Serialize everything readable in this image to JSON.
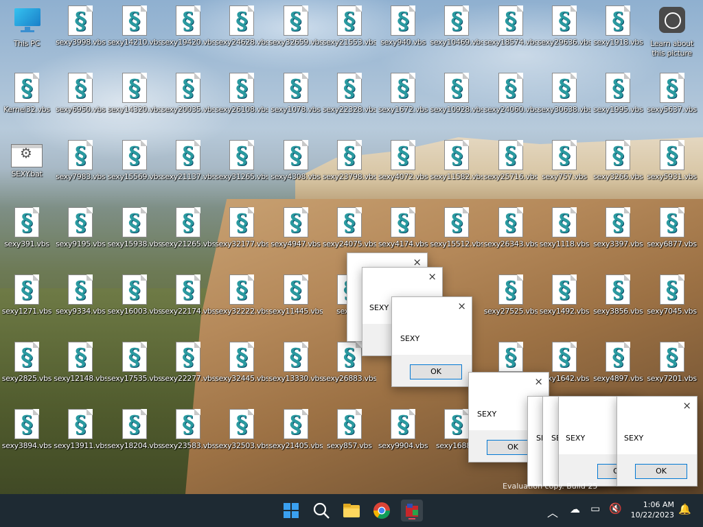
{
  "desktop": {
    "icons": [
      {
        "label": "This PC",
        "kind": "pc"
      },
      {
        "label": "sexy3998.vbs",
        "kind": "vbs"
      },
      {
        "label": "sexy14210.vbs",
        "kind": "vbs"
      },
      {
        "label": "sexy19420.vbs",
        "kind": "vbs"
      },
      {
        "label": "sexy24628.vbs",
        "kind": "vbs"
      },
      {
        "label": "sexy32659.vbs",
        "kind": "vbs"
      },
      {
        "label": "sexy21553.vbs",
        "kind": "vbs"
      },
      {
        "label": "sexy940.vbs",
        "kind": "vbs"
      },
      {
        "label": "sexy10469.vbs",
        "kind": "vbs"
      },
      {
        "label": "sexy18574.vbs",
        "kind": "vbs"
      },
      {
        "label": "sexy29636.vbs",
        "kind": "vbs"
      },
      {
        "label": "sexy1918.vbs",
        "kind": "vbs"
      },
      {
        "label": "Learn about this picture",
        "kind": "camera"
      },
      {
        "label": "Kernel32.vbs",
        "kind": "vbs"
      },
      {
        "label": "sexy6950.vbs",
        "kind": "vbs"
      },
      {
        "label": "sexy14320.vbs",
        "kind": "vbs"
      },
      {
        "label": "sexy20035.vbs",
        "kind": "vbs"
      },
      {
        "label": "sexy26108.vbs",
        "kind": "vbs"
      },
      {
        "label": "sexy1078.vbs",
        "kind": "vbs"
      },
      {
        "label": "sexy22328.vbs",
        "kind": "vbs"
      },
      {
        "label": "sexy1672.vbs",
        "kind": "vbs"
      },
      {
        "label": "sexy10928.vbs",
        "kind": "vbs"
      },
      {
        "label": "sexy24060.vbs",
        "kind": "vbs"
      },
      {
        "label": "sexy30638.vbs",
        "kind": "vbs"
      },
      {
        "label": "sexy1995.vbs",
        "kind": "vbs"
      },
      {
        "label": "sexy5637.vbs",
        "kind": "vbs"
      },
      {
        "label": "SEXY.bat",
        "kind": "bat"
      },
      {
        "label": "sexy7983.vbs",
        "kind": "vbs"
      },
      {
        "label": "sexy15569.vbs",
        "kind": "vbs"
      },
      {
        "label": "sexy21137.vbs",
        "kind": "vbs"
      },
      {
        "label": "sexy31265.vbs",
        "kind": "vbs"
      },
      {
        "label": "sexy4308.vbs",
        "kind": "vbs"
      },
      {
        "label": "sexy23798.vbs",
        "kind": "vbs"
      },
      {
        "label": "sexy4072.vbs",
        "kind": "vbs"
      },
      {
        "label": "sexy11582.vbs",
        "kind": "vbs"
      },
      {
        "label": "sexy25716.vbs",
        "kind": "vbs"
      },
      {
        "label": "sexy757.vbs",
        "kind": "vbs"
      },
      {
        "label": "sexy3266.vbs",
        "kind": "vbs"
      },
      {
        "label": "sexy5931.vbs",
        "kind": "vbs"
      },
      {
        "label": "sexy391.vbs",
        "kind": "vbs"
      },
      {
        "label": "sexy9195.vbs",
        "kind": "vbs"
      },
      {
        "label": "sexy15938.vbs",
        "kind": "vbs"
      },
      {
        "label": "sexy21265.vbs",
        "kind": "vbs"
      },
      {
        "label": "sexy32177.vbs",
        "kind": "vbs"
      },
      {
        "label": "sexy4947.vbs",
        "kind": "vbs"
      },
      {
        "label": "sexy24075.vbs",
        "kind": "vbs"
      },
      {
        "label": "sexy4174.vbs",
        "kind": "vbs"
      },
      {
        "label": "sexy15512.vbs",
        "kind": "vbs"
      },
      {
        "label": "sexy26343.vbs",
        "kind": "vbs"
      },
      {
        "label": "sexy1118.vbs",
        "kind": "vbs"
      },
      {
        "label": "sexy3397.vbs",
        "kind": "vbs"
      },
      {
        "label": "sexy6877.vbs",
        "kind": "vbs"
      },
      {
        "label": "sexy1271.vbs",
        "kind": "vbs"
      },
      {
        "label": "sexy9334.vbs",
        "kind": "vbs"
      },
      {
        "label": "sexy16003.vbs",
        "kind": "vbs"
      },
      {
        "label": "sexy22174.vbs",
        "kind": "vbs"
      },
      {
        "label": "sexy32222.vbs",
        "kind": "vbs"
      },
      {
        "label": "sexy11445.vbs",
        "kind": "vbs"
      },
      {
        "label": "sexy26",
        "kind": "vbs"
      },
      {
        "label": "",
        "kind": "none"
      },
      {
        "label": "",
        "kind": "none"
      },
      {
        "label": "sexy27525.vbs",
        "kind": "vbs"
      },
      {
        "label": "sexy1492.vbs",
        "kind": "vbs"
      },
      {
        "label": "sexy3856.vbs",
        "kind": "vbs"
      },
      {
        "label": "sexy7045.vbs",
        "kind": "vbs"
      },
      {
        "label": "sexy2825.vbs",
        "kind": "vbs"
      },
      {
        "label": "sexy12148.vbs",
        "kind": "vbs"
      },
      {
        "label": "sexy17535.vbs",
        "kind": "vbs"
      },
      {
        "label": "sexy22277.vbs",
        "kind": "vbs"
      },
      {
        "label": "sexy32445.vbs",
        "kind": "vbs"
      },
      {
        "label": "sexy13330.vbs",
        "kind": "vbs"
      },
      {
        "label": "sexy26883.vbs",
        "kind": "vbs"
      },
      {
        "label": "",
        "kind": "none"
      },
      {
        "label": "",
        "kind": "none"
      },
      {
        "label": "",
        "kind": "vbs"
      },
      {
        "label": "sexy1642.vbs",
        "kind": "vbs"
      },
      {
        "label": "sexy4897.vbs",
        "kind": "vbs"
      },
      {
        "label": "sexy7201.vbs",
        "kind": "vbs"
      },
      {
        "label": "sexy3894.vbs",
        "kind": "vbs"
      },
      {
        "label": "sexy13911.vbs",
        "kind": "vbs"
      },
      {
        "label": "sexy18204.vbs",
        "kind": "vbs"
      },
      {
        "label": "sexy23583.vbs",
        "kind": "vbs"
      },
      {
        "label": "sexy32503.vbs",
        "kind": "vbs"
      },
      {
        "label": "sexy21405.vbs",
        "kind": "vbs"
      },
      {
        "label": "sexy857.vbs",
        "kind": "vbs"
      },
      {
        "label": "sexy9904.vbs",
        "kind": "vbs"
      },
      {
        "label": "sexy16887.",
        "kind": "vbs"
      },
      {
        "label": "",
        "kind": "none"
      },
      {
        "label": "",
        "kind": "none"
      },
      {
        "label": "",
        "kind": "none"
      },
      {
        "label": "",
        "kind": "none"
      }
    ]
  },
  "dialogs": [
    {
      "message": "",
      "ok": ""
    },
    {
      "message": "SEXY",
      "ok": ""
    },
    {
      "message": "SEXY",
      "ok": "OK"
    },
    {
      "message": "SEXY",
      "ok": "OK"
    },
    {
      "message": "SE",
      "ok": ""
    },
    {
      "message": "SE",
      "ok": ""
    },
    {
      "message": "SEXY",
      "ok": "OK"
    },
    {
      "message": "SEXY",
      "ok": "OK"
    }
  ],
  "dialog_close_glyph": "×",
  "watermark": "Evaluation copy. Build 25",
  "taskbar": {
    "items": [
      "start-icon",
      "search-icon",
      "file-explorer-icon",
      "chrome-icon",
      "script-app-icon"
    ],
    "time": "1:06 AM",
    "date": "10/22/2023"
  }
}
